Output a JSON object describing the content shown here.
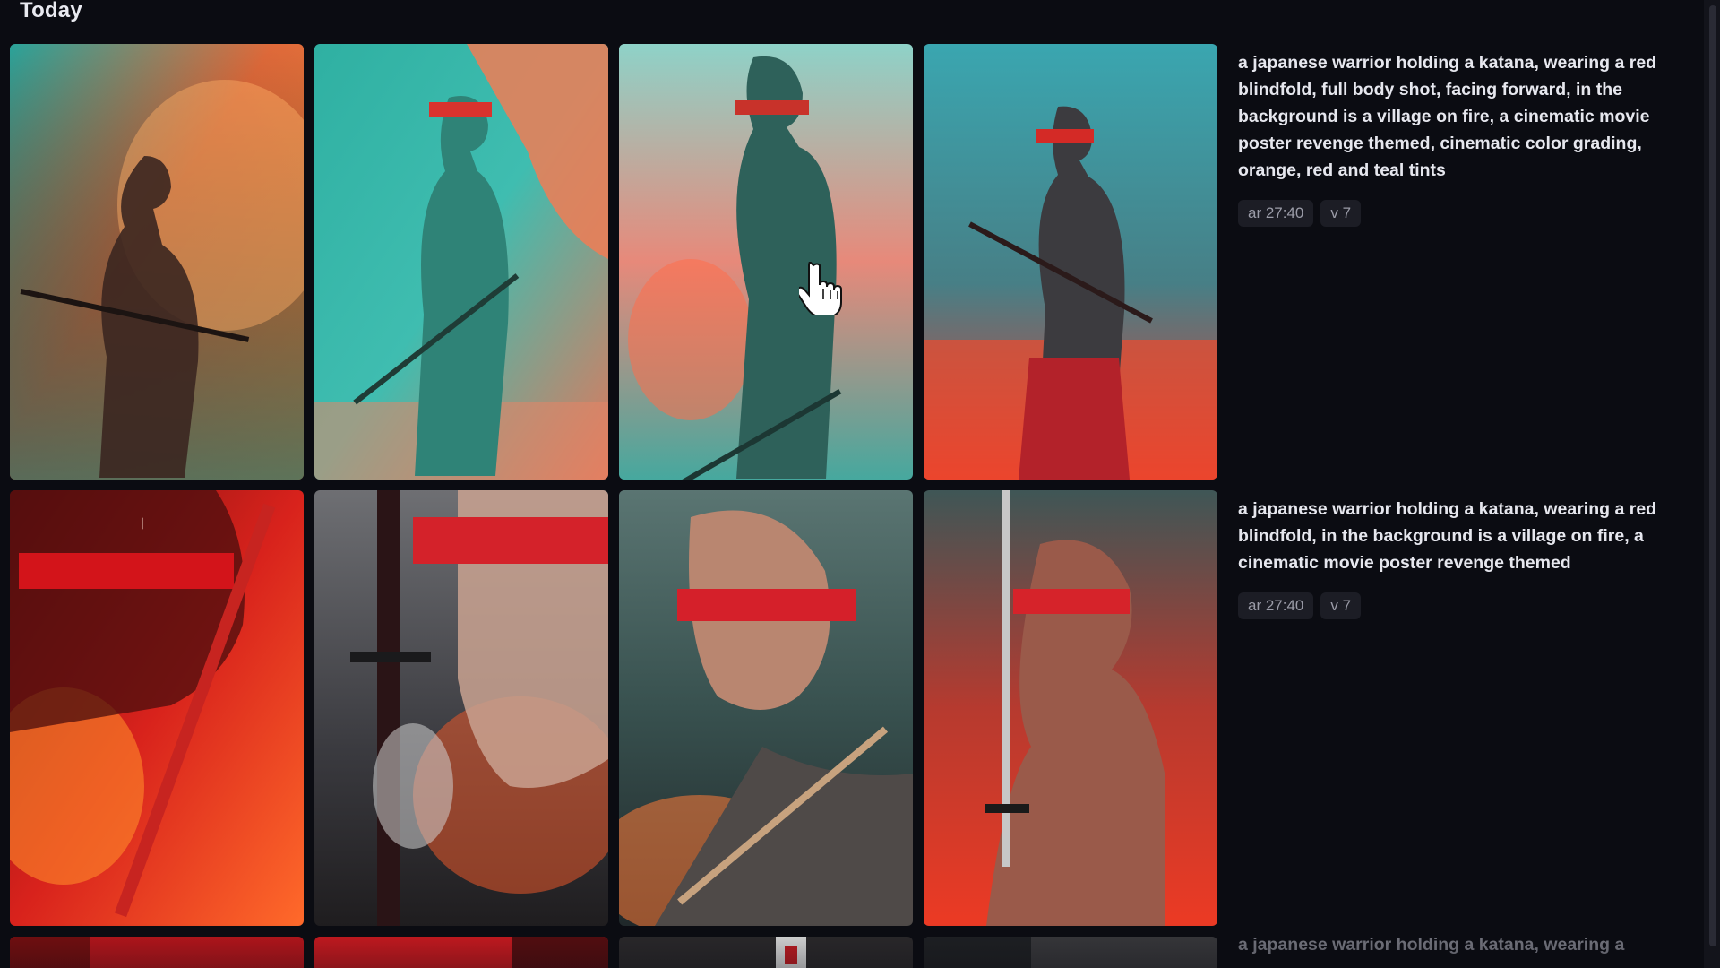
{
  "section": {
    "title": "Today"
  },
  "jobs": [
    {
      "prompt": "a japanese warrior holding a katana, wearing a red blindfold, full body shot, facing forward, in the background is a village on fire, a cinematic movie poster revenge themed, cinematic color grading, orange, red and teal tints",
      "params": [
        "ar 27:40",
        "v 7"
      ],
      "images": [
        {
          "alt": "warrior-teal-orange-fire"
        },
        {
          "alt": "warrior-teal-red-village"
        },
        {
          "alt": "warrior-shirtless-teal-fire"
        },
        {
          "alt": "warrior-red-fire-standing"
        }
      ]
    },
    {
      "prompt": "a japanese warrior holding a katana, wearing a red blindfold, in the background is a village on fire, a cinematic movie poster revenge themed",
      "params": [
        "ar 27:40",
        "v 7"
      ],
      "images": [
        {
          "alt": "warrior-closeup-red-poster"
        },
        {
          "alt": "warrior-closeup-sword-grey"
        },
        {
          "alt": "warrior-village-below-fire"
        },
        {
          "alt": "warrior-profile-red-fire"
        }
      ]
    },
    {
      "prompt": "a japanese warrior holding a katana, wearing a",
      "params": []
    }
  ],
  "colors": {
    "background": "#0b0c12",
    "text": "#e6e7ee",
    "chip_bg": "#1c1d25",
    "chip_text": "#9b9ca8"
  }
}
